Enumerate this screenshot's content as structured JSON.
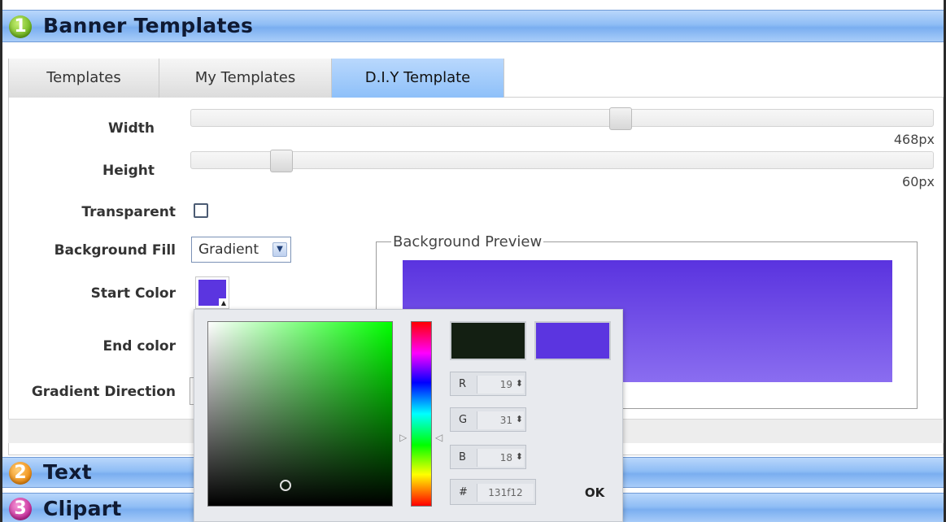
{
  "sections": [
    {
      "number": "1",
      "title": "Banner Templates"
    },
    {
      "number": "2",
      "title": "Text"
    },
    {
      "number": "3",
      "title": "Clipart"
    }
  ],
  "tabs": [
    {
      "label": "Templates",
      "active": false
    },
    {
      "label": "My Templates",
      "active": false
    },
    {
      "label": "D.I.Y Template",
      "active": true
    }
  ],
  "form": {
    "width_label": "Width",
    "width_value": "468px",
    "width_fraction": 0.58,
    "height_label": "Height",
    "height_value": "60px",
    "height_fraction": 0.11,
    "transparent_label": "Transparent",
    "transparent_checked": false,
    "background_fill_label": "Background Fill",
    "background_fill_value": "Gradient",
    "start_color_label": "Start Color",
    "start_color": "#5b35e0",
    "end_color_label": "End color",
    "gradient_direction_label": "Gradient Direction"
  },
  "preview": {
    "legend": "Background Preview",
    "gradient_top": "#5a33df",
    "gradient_bottom": "#8a6df0"
  },
  "color_picker": {
    "hue_color": "#00ff00",
    "new_color": "#131f12",
    "current_color": "#5b35e0",
    "r_label": "R",
    "r_value": "19",
    "g_label": "G",
    "g_value": "31",
    "b_label": "B",
    "b_value": "18",
    "hex_label": "#",
    "hex_value": "131f12",
    "ok_label": "OK"
  }
}
